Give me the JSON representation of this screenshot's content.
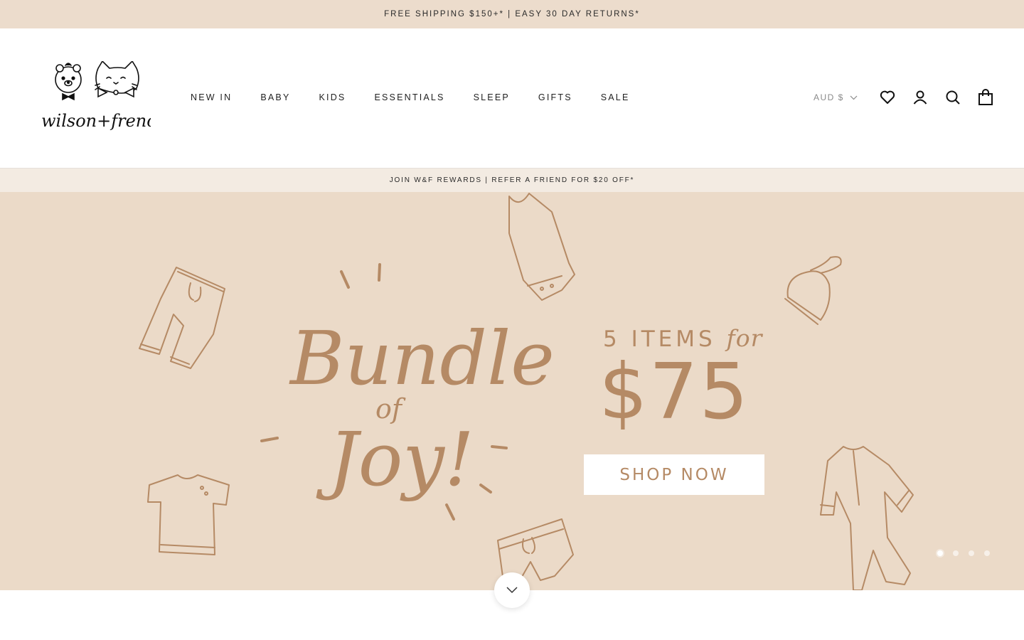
{
  "announcement": {
    "text": "FREE SHIPPING $150+* | EASY 30 DAY RETURNS*"
  },
  "header": {
    "logo_alt": "wilson + frenchy",
    "nav": [
      "NEW IN",
      "BABY",
      "KIDS",
      "ESSENTIALS",
      "SLEEP",
      "GIFTS",
      "SALE"
    ],
    "currency": "AUD $",
    "icons": [
      "heart-icon",
      "account-icon",
      "search-icon",
      "bag-icon"
    ]
  },
  "rewards_bar": {
    "text": "JOIN W&F REWARDS | REFER A FRIEND FOR $20 OFF*"
  },
  "hero": {
    "headline_script": [
      "Bundle",
      "of",
      "Joy!"
    ],
    "promo_prefix": "5 ITEMS",
    "promo_for": "for",
    "price": "$75",
    "cta": "SHOP NOW",
    "slides": 4,
    "active_slide": 1,
    "colors": {
      "background": "#ebdac8",
      "accent": "#b58a65"
    }
  }
}
